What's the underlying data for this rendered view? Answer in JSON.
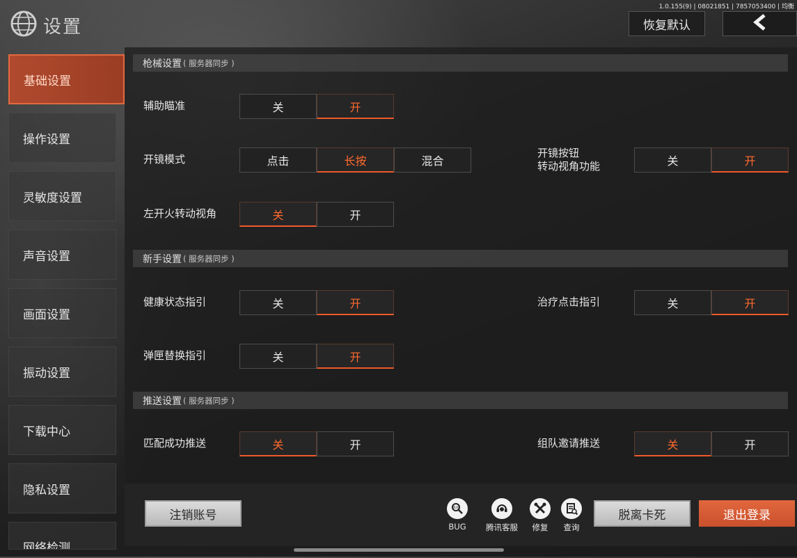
{
  "header": {
    "version": "1.0.155(9) | 08021851 | 7857053400 | 均衡",
    "title": "设置",
    "restore_label": "恢复默认",
    "back_icon": "chevron-left-icon",
    "logo_icon": "globe-logo-icon"
  },
  "sidebar": {
    "items": [
      {
        "label": "基础设置",
        "active": true
      },
      {
        "label": "操作设置"
      },
      {
        "label": "灵敏度设置"
      },
      {
        "label": "声音设置"
      },
      {
        "label": "画面设置"
      },
      {
        "label": "振动设置"
      },
      {
        "label": "下载中心"
      },
      {
        "label": "隐私设置"
      },
      {
        "label": "网络检测"
      }
    ]
  },
  "sections": [
    {
      "title": "枪械设置",
      "sub": "( 服务器同步 )"
    },
    {
      "title": "新手设置",
      "sub": "( 服务器同步 )"
    },
    {
      "title": "推送设置",
      "sub": "( 服务器同步 )"
    }
  ],
  "settings": {
    "aim_assist": {
      "label": "辅助瞄准",
      "options": [
        "关",
        "开"
      ],
      "selected": "开"
    },
    "scope_mode": {
      "label": "开镜模式",
      "options": [
        "点击",
        "长按",
        "混合"
      ],
      "selected": "长按"
    },
    "scope_button_rotate": {
      "label_line1": "开镜按钮",
      "label_line2": "转动视角功能",
      "options": [
        "关",
        "开"
      ],
      "selected": "开"
    },
    "left_fire_rotate": {
      "label": "左开火转动视角",
      "options": [
        "关",
        "开"
      ],
      "selected": "关"
    },
    "health_guide": {
      "label": "健康状态指引",
      "options": [
        "关",
        "开"
      ],
      "selected": "开"
    },
    "heal_click_guide": {
      "label": "治疗点击指引",
      "options": [
        "关",
        "开"
      ],
      "selected": "开"
    },
    "mag_swap_guide": {
      "label": "弹匣替换指引",
      "options": [
        "关",
        "开"
      ],
      "selected": "开"
    },
    "match_push": {
      "label": "匹配成功推送",
      "options": [
        "关",
        "开"
      ],
      "selected": "关"
    },
    "team_invite_push": {
      "label": "组队邀请推送",
      "options": [
        "关",
        "开"
      ],
      "selected": "关"
    }
  },
  "footer": {
    "deregister_label": "注销账号",
    "tools": [
      {
        "label": "BUG",
        "icon": "bug-report-icon"
      },
      {
        "label": "腾讯客服",
        "icon": "customer-service-icon"
      },
      {
        "label": "修复",
        "icon": "repair-tools-icon"
      },
      {
        "label": "查询",
        "icon": "query-document-icon"
      }
    ],
    "unstuck_label": "脱离卡死",
    "logout_label": "退出登录"
  },
  "colors": {
    "accent": "#ef5a2a",
    "active_tab": "#b04a2e",
    "logout": "#d65a33"
  }
}
